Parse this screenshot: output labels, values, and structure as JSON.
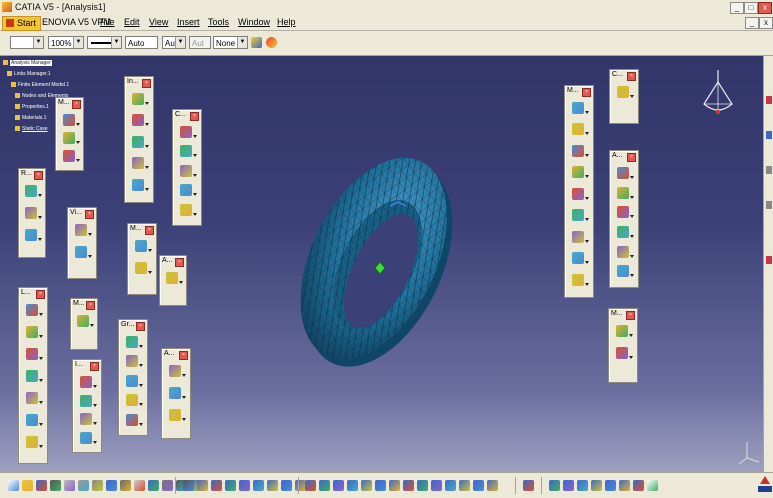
{
  "window": {
    "title": "CATIA V5 - [Analysis1]"
  },
  "menu": {
    "start": "Start",
    "items": [
      "ENOVIA V5 VPM",
      "File",
      "Edit",
      "View",
      "Insert",
      "Tools",
      "Window",
      "Help"
    ]
  },
  "toolbar": {
    "zoom": "100%",
    "auto1": "Auto",
    "auto2": "Aut",
    "auto3": "Aut",
    "none": "None"
  },
  "tree": {
    "root": "Analysis Manager",
    "items": [
      "Links Manager.1",
      "Finite Element Model.1",
      "Nodes and Elements",
      "Properties.1",
      "Materials.1",
      "Static Case"
    ]
  },
  "toolbars": [
    {
      "id": "m1",
      "label": "M..."
    },
    {
      "id": "in",
      "label": "In..."
    },
    {
      "id": "c1",
      "label": "C..."
    },
    {
      "id": "r1",
      "label": "R..."
    },
    {
      "id": "vi",
      "label": "Vi..."
    },
    {
      "id": "m2",
      "label": "M..."
    },
    {
      "id": "a1",
      "label": "A..."
    },
    {
      "id": "l1",
      "label": "L..."
    },
    {
      "id": "m3",
      "label": "M..."
    },
    {
      "id": "i1",
      "label": "I..."
    },
    {
      "id": "gr",
      "label": "Gr..."
    },
    {
      "id": "a2",
      "label": "A..."
    },
    {
      "id": "m4",
      "label": "M..."
    },
    {
      "id": "c2",
      "label": "C..."
    },
    {
      "id": "a3",
      "label": "A..."
    },
    {
      "id": "m5",
      "label": "M..."
    }
  ],
  "icons": {
    "toolbox_close": "close-icon",
    "compass": "compass-icon",
    "axis": "axis-icon",
    "logo": "catia-logo"
  },
  "colors": {
    "viewport_top": "#313568",
    "viewport_bottom": "#9ea0bf",
    "mesh": "#1f6f9a",
    "menu_bg": "#ece9d8"
  }
}
